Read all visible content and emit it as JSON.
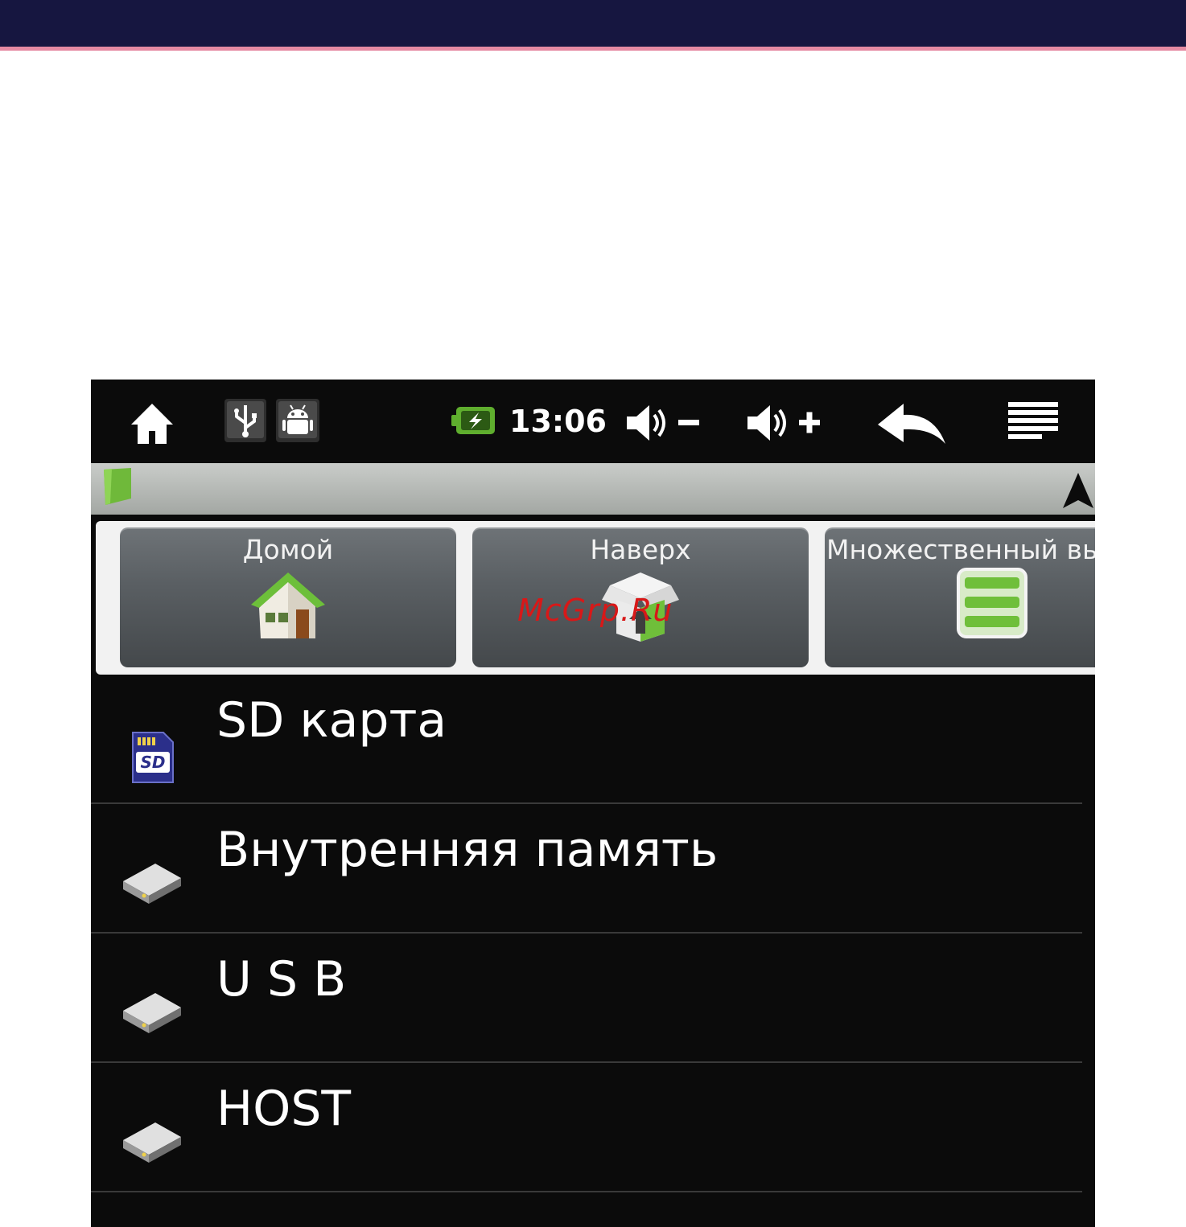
{
  "statusbar": {
    "time": "13:06",
    "icons": [
      "home-icon",
      "usb-icon",
      "android-debug-icon",
      "battery-charging-icon",
      "volume-down-icon",
      "volume-up-icon",
      "back-icon",
      "menu-icon"
    ]
  },
  "toolbar": {
    "home_label": "Домой",
    "up_label": "Наверх",
    "multiselect_label": "Множественный вы"
  },
  "watermark": "McGrp.Ru",
  "files": [
    {
      "label": "SD карта",
      "icon": "sd-card-icon"
    },
    {
      "label": "Внутренняя память",
      "icon": "drive-icon"
    },
    {
      "label": "U S B",
      "icon": "drive-icon"
    },
    {
      "label": "HOST",
      "icon": "drive-icon"
    }
  ],
  "colors": {
    "header": "#161640",
    "header_accent": "#e58aa3",
    "screen_bg": "#0b0b0b",
    "toolbar_bg": "#f2f2f2",
    "icon_green": "#7cc63b",
    "watermark": "#d81818"
  }
}
